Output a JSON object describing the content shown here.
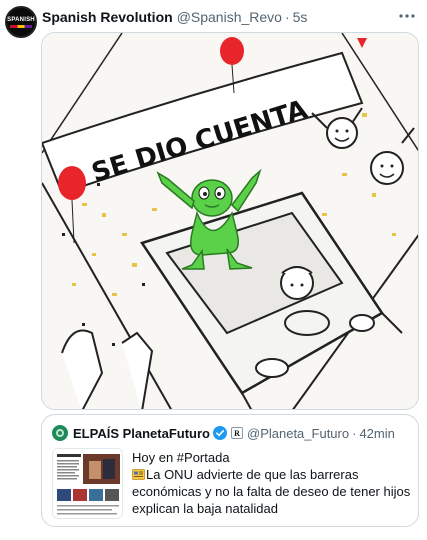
{
  "post": {
    "author_name": "Spanish Revolution",
    "author_handle": "@Spanish_Revo",
    "separator": "·",
    "time": "5s",
    "more_icon": "more-horizontal-icon",
    "avatar_text": "SPANISH"
  },
  "media": {
    "meme_caption": "SE DIO CUENTA"
  },
  "quote": {
    "author_name": "ELPAÍS PlanetaFuturo",
    "author_handle": "@Planeta_Futuro",
    "separator": "·",
    "time": "42min",
    "line1": "Hoy en #Portada",
    "line2": "La ONU advierte de que las barreras económicas y no la falta de deseo de tener hijos explican la baja natalidad",
    "line3": "...",
    "affiliate_badge": "R"
  },
  "colors": {
    "text_primary": "#0f1419",
    "text_secondary": "#536471",
    "border": "#cfd9de",
    "verified_blue": "#1d9bf0"
  }
}
